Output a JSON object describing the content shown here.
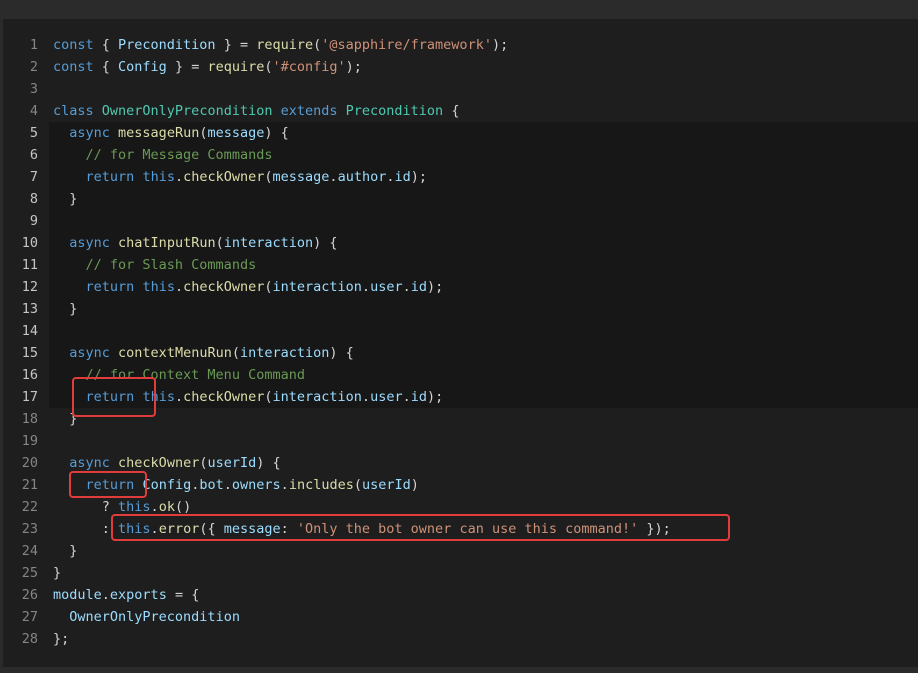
{
  "editor": {
    "lines": [
      {
        "n": "1",
        "t": [
          [
            "kw",
            "const"
          ],
          [
            "pl",
            " { "
          ],
          [
            "var",
            "Precondition"
          ],
          [
            "pl",
            " } = "
          ],
          [
            "fn",
            "require"
          ],
          [
            "pl",
            "("
          ],
          [
            "str",
            "'@sapphire/framework'"
          ],
          [
            "pl",
            ");"
          ]
        ]
      },
      {
        "n": "2",
        "t": [
          [
            "kw",
            "const"
          ],
          [
            "pl",
            " { "
          ],
          [
            "var",
            "Config"
          ],
          [
            "pl",
            " } = "
          ],
          [
            "fn",
            "require"
          ],
          [
            "pl",
            "("
          ],
          [
            "str",
            "'#config'"
          ],
          [
            "pl",
            ");"
          ]
        ]
      },
      {
        "n": "3",
        "t": []
      },
      {
        "n": "4",
        "t": [
          [
            "kw",
            "class"
          ],
          [
            "pl",
            " "
          ],
          [
            "cls",
            "OwnerOnlyPrecondition"
          ],
          [
            "pl",
            " "
          ],
          [
            "kw",
            "extends"
          ],
          [
            "pl",
            " "
          ],
          [
            "cls",
            "Precondition"
          ],
          [
            "pl",
            " {"
          ]
        ]
      },
      {
        "n": "5",
        "t": [
          [
            "pl",
            "  "
          ],
          [
            "kw",
            "async"
          ],
          [
            "pl",
            " "
          ],
          [
            "fn",
            "messageRun"
          ],
          [
            "pl",
            "("
          ],
          [
            "var",
            "message"
          ],
          [
            "pl",
            ") {"
          ]
        ]
      },
      {
        "n": "6",
        "t": [
          [
            "pl",
            "    "
          ],
          [
            "cmt",
            "// for Message Commands"
          ]
        ]
      },
      {
        "n": "7",
        "t": [
          [
            "pl",
            "    "
          ],
          [
            "kw",
            "return"
          ],
          [
            "pl",
            " "
          ],
          [
            "kw",
            "this"
          ],
          [
            "pl",
            "."
          ],
          [
            "fn",
            "checkOwner"
          ],
          [
            "pl",
            "("
          ],
          [
            "var",
            "message"
          ],
          [
            "pl",
            "."
          ],
          [
            "var",
            "author"
          ],
          [
            "pl",
            "."
          ],
          [
            "var",
            "id"
          ],
          [
            "pl",
            ");"
          ]
        ]
      },
      {
        "n": "8",
        "t": [
          [
            "pl",
            "  }"
          ]
        ]
      },
      {
        "n": "9",
        "t": []
      },
      {
        "n": "10",
        "t": [
          [
            "pl",
            "  "
          ],
          [
            "kw",
            "async"
          ],
          [
            "pl",
            " "
          ],
          [
            "fn",
            "chatInputRun"
          ],
          [
            "pl",
            "("
          ],
          [
            "var",
            "interaction"
          ],
          [
            "pl",
            ") {"
          ]
        ]
      },
      {
        "n": "11",
        "t": [
          [
            "pl",
            "    "
          ],
          [
            "cmt",
            "// for Slash Commands"
          ]
        ]
      },
      {
        "n": "12",
        "t": [
          [
            "pl",
            "    "
          ],
          [
            "kw",
            "return"
          ],
          [
            "pl",
            " "
          ],
          [
            "kw",
            "this"
          ],
          [
            "pl",
            "."
          ],
          [
            "fn",
            "checkOwner"
          ],
          [
            "pl",
            "("
          ],
          [
            "var",
            "interaction"
          ],
          [
            "pl",
            "."
          ],
          [
            "var",
            "user"
          ],
          [
            "pl",
            "."
          ],
          [
            "var",
            "id"
          ],
          [
            "pl",
            ");"
          ]
        ]
      },
      {
        "n": "13",
        "t": [
          [
            "pl",
            "  }"
          ]
        ]
      },
      {
        "n": "14",
        "t": []
      },
      {
        "n": "15",
        "t": [
          [
            "pl",
            "  "
          ],
          [
            "kw",
            "async"
          ],
          [
            "pl",
            " "
          ],
          [
            "fn",
            "contextMenuRun"
          ],
          [
            "pl",
            "("
          ],
          [
            "var",
            "interaction"
          ],
          [
            "pl",
            ") {"
          ]
        ]
      },
      {
        "n": "16",
        "t": [
          [
            "pl",
            "    "
          ],
          [
            "cmt",
            "// for Context Menu Command"
          ]
        ]
      },
      {
        "n": "17",
        "t": [
          [
            "pl",
            "    "
          ],
          [
            "kw",
            "return"
          ],
          [
            "pl",
            " "
          ],
          [
            "kw",
            "this"
          ],
          [
            "pl",
            "."
          ],
          [
            "fn",
            "checkOwner"
          ],
          [
            "pl",
            "("
          ],
          [
            "var",
            "interaction"
          ],
          [
            "pl",
            "."
          ],
          [
            "var",
            "user"
          ],
          [
            "pl",
            "."
          ],
          [
            "var",
            "id"
          ],
          [
            "pl",
            ");"
          ]
        ]
      },
      {
        "n": "18",
        "t": [
          [
            "pl",
            "  }"
          ]
        ]
      },
      {
        "n": "19",
        "t": []
      },
      {
        "n": "20",
        "t": [
          [
            "pl",
            "  "
          ],
          [
            "kw",
            "async"
          ],
          [
            "pl",
            " "
          ],
          [
            "fn",
            "checkOwner"
          ],
          [
            "pl",
            "("
          ],
          [
            "var",
            "userId"
          ],
          [
            "pl",
            ") {"
          ]
        ]
      },
      {
        "n": "21",
        "t": [
          [
            "pl",
            "    "
          ],
          [
            "kw",
            "return"
          ],
          [
            "pl",
            " "
          ],
          [
            "var",
            "Config"
          ],
          [
            "pl",
            "."
          ],
          [
            "var",
            "bot"
          ],
          [
            "pl",
            "."
          ],
          [
            "var",
            "owners"
          ],
          [
            "pl",
            "."
          ],
          [
            "fn",
            "includes"
          ],
          [
            "pl",
            "("
          ],
          [
            "var",
            "userId"
          ],
          [
            "pl",
            ")"
          ]
        ]
      },
      {
        "n": "22",
        "t": [
          [
            "pl",
            "      ? "
          ],
          [
            "kw",
            "this"
          ],
          [
            "pl",
            "."
          ],
          [
            "fn",
            "ok"
          ],
          [
            "pl",
            "()"
          ]
        ]
      },
      {
        "n": "23",
        "t": [
          [
            "pl",
            "      : "
          ],
          [
            "kw",
            "this"
          ],
          [
            "pl",
            "."
          ],
          [
            "fn",
            "error"
          ],
          [
            "pl",
            "({ "
          ],
          [
            "var",
            "message"
          ],
          [
            "pl",
            ": "
          ],
          [
            "str",
            "'Only the bot owner can use this command!'"
          ],
          [
            "pl",
            " });"
          ]
        ]
      },
      {
        "n": "24",
        "t": [
          [
            "pl",
            "  }"
          ]
        ]
      },
      {
        "n": "25",
        "t": [
          [
            "pl",
            "}"
          ]
        ]
      },
      {
        "n": "26",
        "t": [
          [
            "var",
            "module"
          ],
          [
            "pl",
            "."
          ],
          [
            "var",
            "exports"
          ],
          [
            "pl",
            " = {"
          ]
        ]
      },
      {
        "n": "27",
        "t": [
          [
            "pl",
            "  "
          ],
          [
            "var",
            "OwnerOnlyPrecondition"
          ]
        ]
      },
      {
        "n": "28",
        "t": [
          [
            "pl",
            "};"
          ]
        ]
      }
    ],
    "bright_line_numbers": [
      "5",
      "6",
      "7",
      "8",
      "9",
      "10",
      "11",
      "12",
      "13",
      "14",
      "15",
      "16",
      "17"
    ],
    "annotation_color": "#e03c3c"
  }
}
